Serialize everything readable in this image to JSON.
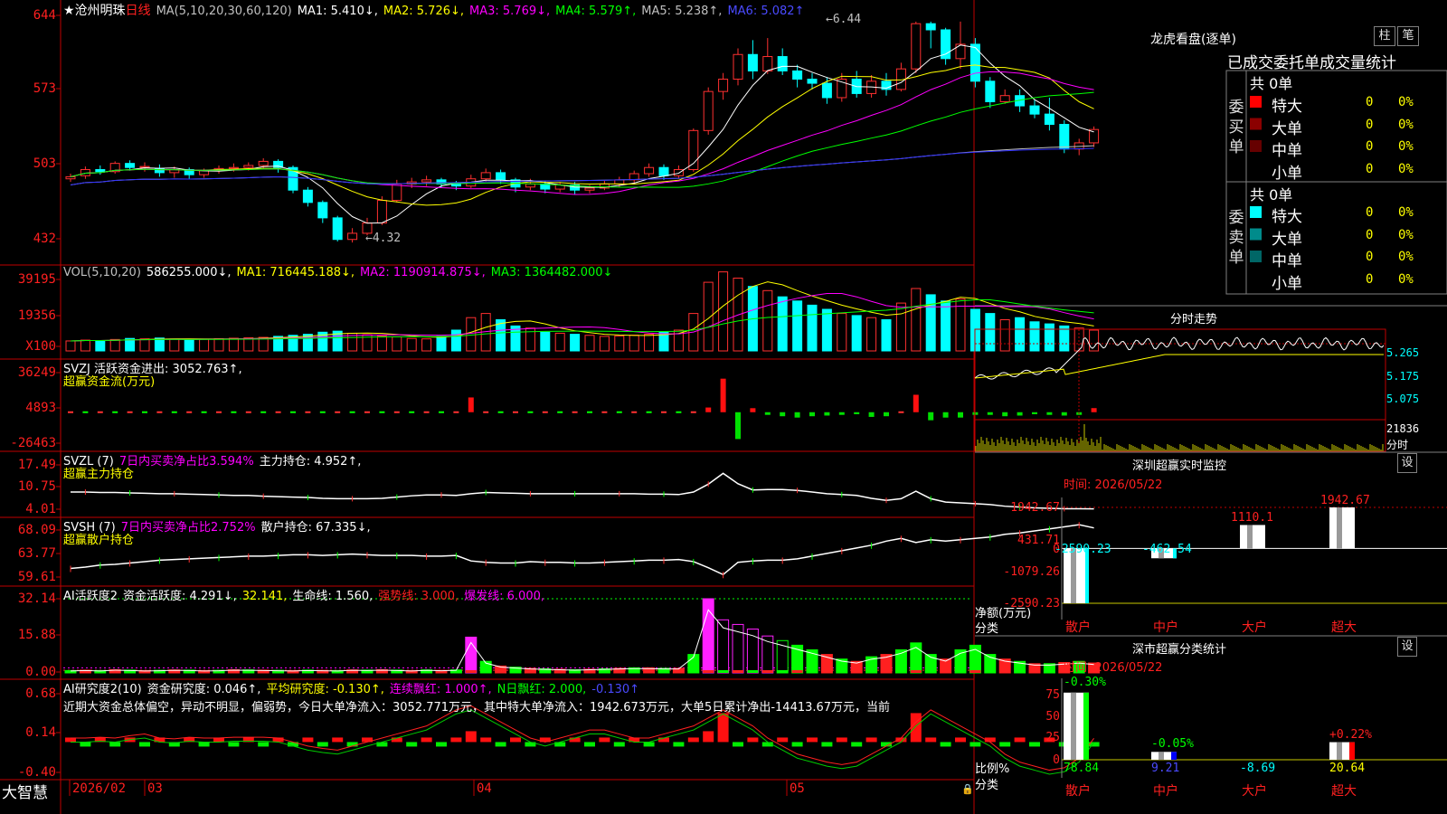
{
  "stock": {
    "name": "沧州明珠",
    "period": "日线"
  },
  "main": {
    "y_ticks": [
      "644",
      "573",
      "503",
      "432"
    ],
    "indicators": [
      {
        "text": "MA(5,10,20,30,60,120)",
        "color": "#c0c0c0"
      },
      {
        "text": "MA1: 5.410↓,",
        "color": "#ffffff"
      },
      {
        "text": "MA2: 5.726↓,",
        "color": "#ffff00"
      },
      {
        "text": "MA3: 5.769↓,",
        "color": "#ff00ff"
      },
      {
        "text": "MA4: 5.579↑,",
        "color": "#00ff00"
      },
      {
        "text": "MA5: 5.238↑,",
        "color": "#c0c0c0"
      },
      {
        "text": "MA6: 5.082↑",
        "color": "#4a4aff"
      }
    ],
    "high_label": "6.44",
    "low_label": "4.32"
  },
  "vol": {
    "y_ticks": [
      "39195",
      "19356",
      "X100"
    ],
    "indicators": [
      {
        "text": "VOL(5,10,20)",
        "color": "#c0c0c0"
      },
      {
        "text": "586255.000↓,",
        "color": "#ffffff"
      },
      {
        "text": "MA1: 716445.188↓,",
        "color": "#ffff00"
      },
      {
        "text": "MA2: 1190914.875↓,",
        "color": "#ff00ff"
      },
      {
        "text": "MA3: 1364482.000↓",
        "color": "#00ff00"
      }
    ]
  },
  "svzj": {
    "y_ticks": [
      "36249",
      "4893",
      "-26463"
    ],
    "line1": [
      {
        "text": "SVZJ 活跃资金进出: 3052.763↑,",
        "color": "#ffffff"
      }
    ],
    "line2": "超赢资金流(万元)"
  },
  "svzl": {
    "y_ticks": [
      "17.49",
      "10.75",
      "4.01"
    ],
    "line1": [
      {
        "text": "SVZL (7)",
        "color": "#ffffff"
      },
      {
        "text": "7日内买卖净占比3.594%",
        "color": "#ff00ff"
      },
      {
        "text": "主力持仓: 4.952↑,",
        "color": "#ffffff"
      }
    ],
    "line2": "超赢主力持仓"
  },
  "svsh": {
    "y_ticks": [
      "68.09",
      "63.77",
      "59.61"
    ],
    "line1": [
      {
        "text": "SVSH (7)",
        "color": "#ffffff"
      },
      {
        "text": "7日内买卖净占比2.752%",
        "color": "#ff00ff"
      },
      {
        "text": "散户持仓: 67.335↓,",
        "color": "#ffffff"
      }
    ],
    "line2": "超赢散户持仓"
  },
  "ai1": {
    "y_ticks": [
      "32.14",
      "15.88",
      "0.00"
    ],
    "line1": [
      {
        "text": "AI活跃度2",
        "color": "#ffffff"
      },
      {
        "text": "资金活跃度: 4.291↓,",
        "color": "#ffffff"
      },
      {
        "text": "32.141,",
        "color": "#ffff00"
      },
      {
        "text": "生命线: 1.560,",
        "color": "#ffffff"
      },
      {
        "text": "强势线: 3.000,",
        "color": "#ff2020"
      },
      {
        "text": "爆发线: 6.000,",
        "color": "#ff00ff"
      }
    ]
  },
  "ai2": {
    "y_ticks": [
      "0.68",
      "0.14",
      "-0.40"
    ],
    "line1": [
      {
        "text": "AI研究度2(10)",
        "color": "#ffffff"
      },
      {
        "text": "资金研究度: 0.046↑,",
        "color": "#ffffff"
      },
      {
        "text": "平均研究度: -0.130↑,",
        "color": "#ffff00"
      },
      {
        "text": "连续飘红: 1.000↑,",
        "color": "#ff00ff"
      },
      {
        "text": "N日飘红: 2.000,",
        "color": "#00ff00"
      },
      {
        "text": "-0.130↑",
        "color": "#4a4aff"
      }
    ],
    "commentary": "近期大资金总体偏空，异动不明显，偏弱势，今日大单净流入：3052.771万元，其中特大单净流入：1942.673万元，大单5日累计净出-14413.67万元，当前"
  },
  "xaxis": {
    "app": "大智慧",
    "labels": [
      {
        "text": "2026/02",
        "x": 80
      },
      {
        "text": "03",
        "x": 163
      },
      {
        "text": "04",
        "x": 527
      },
      {
        "text": "05",
        "x": 873
      }
    ]
  },
  "tiger": {
    "title": "龙虎看盘(逐单)",
    "btn1": "柱",
    "btn2": "笔",
    "subtitle": "已成交委托单成交量统计",
    "buy_label": "委买单",
    "sell_label": "委卖单",
    "buy": {
      "total": "共 0单",
      "rows": [
        {
          "name": "特大",
          "count": "0",
          "pct": "0%",
          "color": "#ff0000"
        },
        {
          "name": "大单",
          "count": "0",
          "pct": "0%",
          "color": "#8b0000"
        },
        {
          "name": "中单",
          "count": "0",
          "pct": "0%",
          "color": "#660000"
        },
        {
          "name": "小单",
          "count": "0",
          "pct": "0%",
          "color": "#000000"
        }
      ]
    },
    "sell": {
      "total": "共 0单",
      "rows": [
        {
          "name": "特大",
          "count": "0",
          "pct": "0%",
          "color": "#00ffff"
        },
        {
          "name": "大单",
          "count": "0",
          "pct": "0%",
          "color": "#008b8b"
        },
        {
          "name": "中单",
          "count": "0",
          "pct": "0%",
          "color": "#006666"
        },
        {
          "name": "小单",
          "count": "0",
          "pct": "0%",
          "color": "#000000"
        }
      ]
    }
  },
  "intraday": {
    "title": "分时走势",
    "price_ticks": [
      "5.265",
      "5.175",
      "5.075"
    ],
    "vol_ticks": [
      "21836",
      "分时"
    ]
  },
  "monitor": {
    "title": "深圳超赢实时监控",
    "btn": "设",
    "time": "时间: 2026/05/22",
    "y_ticks": [
      "1942.67",
      "431.71",
      "0",
      "-1079.26",
      "-2590.23"
    ],
    "ylabel": "净额(万元)",
    "xlabel": "分类",
    "categories": [
      "散户",
      "中户",
      "大户",
      "超大"
    ],
    "values": [
      -2590.23,
      -462.54,
      1110.1,
      1942.67
    ],
    "value_labels": [
      "-2590.23",
      "-462.54",
      "1110.1",
      "1942.67"
    ],
    "label_colors": [
      "#00ffff",
      "#00ffff",
      "#ff2020",
      "#ff2020"
    ],
    "ylim": [
      -2590.23,
      1942.67
    ]
  },
  "classify": {
    "title": "深市超赢分类统计",
    "btn": "设",
    "time": "时间: 2026/05/22",
    "y_ticks": [
      "75",
      "50",
      "25",
      "0"
    ],
    "ylabel": "比例%",
    "xlabel": "分类",
    "categories": [
      "散户",
      "中户",
      "大户",
      "超大"
    ],
    "values": [
      78.84,
      9.21,
      -8.69,
      20.64
    ],
    "value_labels": [
      "78.84",
      "9.21",
      "-8.69",
      "20.64"
    ],
    "top_labels": [
      "-0.30%",
      "-0.05%",
      "",
      "+0.22%"
    ],
    "top_colors": [
      "#00ff00",
      "#00ff00",
      "#00ff00",
      "#ff2020"
    ],
    "val_colors": [
      "#00ff00",
      "#4a4aff",
      "#00ffff",
      "#ffff00"
    ],
    "ylim": [
      0,
      85
    ]
  },
  "chart_data": [
    {
      "type": "candlestick",
      "title": "沧州明珠 日线",
      "ylim": [
        4.1,
        6.6
      ],
      "grid": false,
      "series": [
        {
          "name": "MA1",
          "values": [
            5.41
          ]
        },
        {
          "name": "MA2",
          "values": [
            5.726
          ]
        },
        {
          "name": "MA3",
          "values": [
            5.769
          ]
        },
        {
          "name": "MA4",
          "values": [
            5.579
          ]
        },
        {
          "name": "MA5",
          "values": [
            5.238
          ]
        },
        {
          "name": "MA6",
          "values": [
            5.082
          ]
        }
      ],
      "candles": [
        [
          4.93,
          4.95,
          4.98,
          4.9
        ],
        [
          4.96,
          5.02,
          5.05,
          4.93
        ],
        [
          5.02,
          5.0,
          5.06,
          4.97
        ],
        [
          5.0,
          5.08,
          5.1,
          4.98
        ],
        [
          5.08,
          5.04,
          5.11,
          5.01
        ],
        [
          5.04,
          5.05,
          5.09,
          5.0
        ],
        [
          5.03,
          4.99,
          5.07,
          4.95
        ],
        [
          4.99,
          5.02,
          5.05,
          4.94
        ],
        [
          5.02,
          4.97,
          5.04,
          4.93
        ],
        [
          4.97,
          5.01,
          5.03,
          4.94
        ],
        [
          5.01,
          5.03,
          5.06,
          4.98
        ],
        [
          5.03,
          5.04,
          5.08,
          5.0
        ],
        [
          5.04,
          5.06,
          5.09,
          5.01
        ],
        [
          5.06,
          5.1,
          5.13,
          5.03
        ],
        [
          5.1,
          5.04,
          5.12,
          4.99
        ],
        [
          5.04,
          4.82,
          5.06,
          4.79
        ],
        [
          4.82,
          4.7,
          4.85,
          4.66
        ],
        [
          4.7,
          4.55,
          4.72,
          4.5
        ],
        [
          4.55,
          4.34,
          4.57,
          4.32
        ],
        [
          4.34,
          4.4,
          4.45,
          4.31
        ],
        [
          4.4,
          4.5,
          4.55,
          4.38
        ],
        [
          4.5,
          4.72,
          4.76,
          4.48
        ],
        [
          4.72,
          4.88,
          4.92,
          4.7
        ],
        [
          4.88,
          4.9,
          4.94,
          4.84
        ],
        [
          4.9,
          4.92,
          4.96,
          4.86
        ],
        [
          4.92,
          4.88,
          4.94,
          4.84
        ],
        [
          4.88,
          4.86,
          4.91,
          4.82
        ],
        [
          4.86,
          4.93,
          4.97,
          4.84
        ],
        [
          4.93,
          4.99,
          5.03,
          4.9
        ],
        [
          4.99,
          4.92,
          5.02,
          4.88
        ],
        [
          4.92,
          4.85,
          4.94,
          4.8
        ],
        [
          4.85,
          4.88,
          4.93,
          4.82
        ],
        [
          4.88,
          4.83,
          4.91,
          4.79
        ],
        [
          4.83,
          4.87,
          4.9,
          4.8
        ],
        [
          4.87,
          4.82,
          4.9,
          4.78
        ],
        [
          4.82,
          4.84,
          4.87,
          4.79
        ],
        [
          4.84,
          4.88,
          4.91,
          4.82
        ],
        [
          4.88,
          4.92,
          4.95,
          4.85
        ],
        [
          4.92,
          4.98,
          5.01,
          4.88
        ],
        [
          4.98,
          5.04,
          5.08,
          4.95
        ],
        [
          5.04,
          4.96,
          5.07,
          4.92
        ],
        [
          4.96,
          5.02,
          5.06,
          4.93
        ],
        [
          5.02,
          5.4,
          5.42,
          5.0
        ],
        [
          5.4,
          5.78,
          5.82,
          5.36
        ],
        [
          5.78,
          5.9,
          5.96,
          5.7
        ],
        [
          5.9,
          6.14,
          6.2,
          5.84
        ],
        [
          6.14,
          5.98,
          6.28,
          5.9
        ],
        [
          5.98,
          6.12,
          6.3,
          5.95
        ],
        [
          6.12,
          5.98,
          6.2,
          5.94
        ],
        [
          5.98,
          5.9,
          6.04,
          5.82
        ],
        [
          5.9,
          5.86,
          5.96,
          5.8
        ],
        [
          5.86,
          5.72,
          5.92,
          5.66
        ],
        [
          5.72,
          5.9,
          5.96,
          5.68
        ],
        [
          5.9,
          5.76,
          5.98,
          5.72
        ],
        [
          5.76,
          5.88,
          5.94,
          5.72
        ],
        [
          5.88,
          5.8,
          5.96,
          5.74
        ],
        [
          5.8,
          6.0,
          6.06,
          5.78
        ],
        [
          6.0,
          6.44,
          6.46,
          5.96
        ],
        [
          6.44,
          6.38,
          6.46,
          6.2
        ],
        [
          6.38,
          6.1,
          6.4,
          6.04
        ],
        [
          6.1,
          6.24,
          6.46,
          6.0
        ],
        [
          6.24,
          5.88,
          6.3,
          5.82
        ],
        [
          5.88,
          5.68,
          5.92,
          5.62
        ],
        [
          5.68,
          5.74,
          5.8,
          5.66
        ],
        [
          5.74,
          5.64,
          5.8,
          5.58
        ],
        [
          5.64,
          5.56,
          5.7,
          5.52
        ],
        [
          5.56,
          5.46,
          5.72,
          5.4
        ],
        [
          5.46,
          5.22,
          5.5,
          5.18
        ],
        [
          5.22,
          5.28,
          5.32,
          5.16
        ],
        [
          5.28,
          5.41,
          5.44,
          5.24
        ]
      ]
    },
    {
      "type": "bar",
      "title": "VOL(5,10,20)",
      "ylim": [
        0,
        400000
      ],
      "values": [
        48000,
        52000,
        50000,
        55000,
        60000,
        58000,
        62000,
        57000,
        54000,
        56000,
        59000,
        61000,
        63000,
        65000,
        70000,
        75000,
        80000,
        90000,
        95000,
        85000,
        78000,
        72000,
        68000,
        60000,
        58000,
        70000,
        100000,
        160000,
        180000,
        150000,
        120000,
        110000,
        90000,
        85000,
        80000,
        75000,
        70000,
        72000,
        76000,
        80000,
        90000,
        100000,
        180000,
        330000,
        380000,
        350000,
        310000,
        290000,
        260000,
        240000,
        220000,
        200000,
        180000,
        170000,
        160000,
        150000,
        230000,
        300000,
        270000,
        240000,
        250000,
        200000,
        180000,
        150000,
        160000,
        140000,
        130000,
        120000,
        110000,
        100000
      ]
    },
    {
      "type": "bar",
      "title": "超赢资金流(万元)",
      "ylim": [
        -26463,
        36249
      ],
      "values": [
        0,
        0,
        0,
        0,
        0,
        0,
        0,
        0,
        0,
        0,
        0,
        0,
        0,
        0,
        0,
        0,
        0,
        0,
        0,
        0,
        0,
        0,
        0,
        0,
        0,
        0,
        0,
        11000,
        0,
        0,
        0,
        0,
        0,
        0,
        0,
        0,
        0,
        0,
        0,
        0,
        0,
        0,
        0,
        3500,
        25000,
        -20000,
        3000,
        -2000,
        -3000,
        -4000,
        -3000,
        -2500,
        -2000,
        -1500,
        -3500,
        -3000,
        0,
        13000,
        -6000,
        -4000,
        -4000,
        -2000,
        -2000,
        -3000,
        -2500,
        -1500,
        -2000,
        -2500,
        -2000,
        3052.763
      ]
    },
    {
      "type": "line",
      "title": "超赢主力持仓",
      "ylim": [
        4.01,
        17.49
      ],
      "values": [
        9.0,
        9.0,
        8.9,
        8.9,
        8.8,
        8.7,
        8.6,
        8.6,
        8.5,
        8.4,
        8.3,
        8.2,
        8.2,
        8.0,
        7.9,
        7.8,
        7.7,
        7.5,
        7.4,
        7.4,
        7.4,
        7.5,
        7.8,
        8.1,
        8.3,
        8.3,
        8.2,
        8.6,
        8.9,
        8.8,
        8.7,
        8.6,
        8.6,
        8.6,
        8.6,
        8.6,
        8.6,
        8.6,
        8.6,
        8.5,
        8.5,
        8.4,
        9.0,
        10.9,
        13.5,
        11.0,
        9.5,
        9.6,
        9.6,
        9.4,
        9.0,
        8.6,
        8.4,
        8.2,
        7.5,
        7.0,
        7.4,
        9.2,
        7.4,
        6.6,
        6.4,
        6.2,
        6.0,
        5.6,
        5.4,
        5.2,
        5.1,
        5.0,
        5.0,
        4.952
      ]
    },
    {
      "type": "line",
      "title": "超赢散户持仓",
      "ylim": [
        59.61,
        68.09
      ],
      "values": [
        61.4,
        61.6,
        61.9,
        62.0,
        62.2,
        62.4,
        62.6,
        62.7,
        62.8,
        62.9,
        63.0,
        63.1,
        63.2,
        63.2,
        63.3,
        63.4,
        63.4,
        63.3,
        63.4,
        63.5,
        63.4,
        63.3,
        63.3,
        63.3,
        63.2,
        63.2,
        63.3,
        62.5,
        62.3,
        62.2,
        62.2,
        62.4,
        62.3,
        62.3,
        62.2,
        62.2,
        62.3,
        62.4,
        62.5,
        62.6,
        62.6,
        62.7,
        62.4,
        61.5,
        60.5,
        62.3,
        62.5,
        62.6,
        62.6,
        62.8,
        63.2,
        63.6,
        64.0,
        64.4,
        64.8,
        65.4,
        65.8,
        65.2,
        65.6,
        65.4,
        65.6,
        65.8,
        66.0,
        66.4,
        66.6,
        66.9,
        67.2,
        67.5,
        67.8,
        67.335
      ]
    },
    {
      "type": "bar",
      "title": "AI活跃度2",
      "ylim": [
        0,
        32.14
      ],
      "values": [
        1,
        1.2,
        1,
        1.4,
        1.2,
        1,
        1.1,
        1.3,
        1.2,
        1,
        1.1,
        1.4,
        1.3,
        1.2,
        1.1,
        1,
        1.2,
        1.1,
        1,
        1.3,
        1.2,
        1.4,
        1.2,
        1,
        1.3,
        1.1,
        1.3,
        15.5,
        5,
        3,
        2.5,
        2,
        1.8,
        1.6,
        1.4,
        1.6,
        1.8,
        2,
        2.2,
        2.2,
        2,
        2,
        8,
        32.14,
        23,
        21,
        19,
        16,
        14,
        12,
        10,
        8,
        6,
        5,
        7,
        8,
        10,
        13,
        8,
        6,
        10,
        12,
        8,
        6,
        5,
        4,
        4,
        4.5,
        5,
        4.291
      ]
    },
    {
      "type": "line",
      "title": "AI研究度2(10)",
      "ylim": [
        -0.4,
        0.68
      ],
      "values": [
        0.05,
        0.05,
        0.06,
        0.05,
        0.08,
        0.1,
        0.05,
        0.04,
        0.06,
        0.05,
        0.05,
        0.06,
        0.06,
        0.06,
        0.05,
        0.0,
        -0.05,
        -0.08,
        -0.1,
        -0.05,
        0.0,
        0.05,
        0.1,
        0.15,
        0.2,
        0.3,
        0.4,
        0.45,
        0.35,
        0.25,
        0.15,
        0.05,
        0.0,
        0.05,
        0.1,
        0.15,
        0.15,
        0.1,
        0.05,
        0.05,
        0.1,
        0.15,
        0.2,
        0.3,
        0.4,
        0.3,
        0.2,
        0.05,
        -0.05,
        -0.15,
        -0.2,
        -0.25,
        -0.28,
        -0.25,
        -0.15,
        -0.05,
        0.05,
        0.25,
        0.4,
        0.3,
        0.2,
        0.1,
        0.0,
        -0.15,
        -0.25,
        -0.3,
        -0.35,
        -0.32,
        -0.2,
        0.046
      ]
    }
  ]
}
